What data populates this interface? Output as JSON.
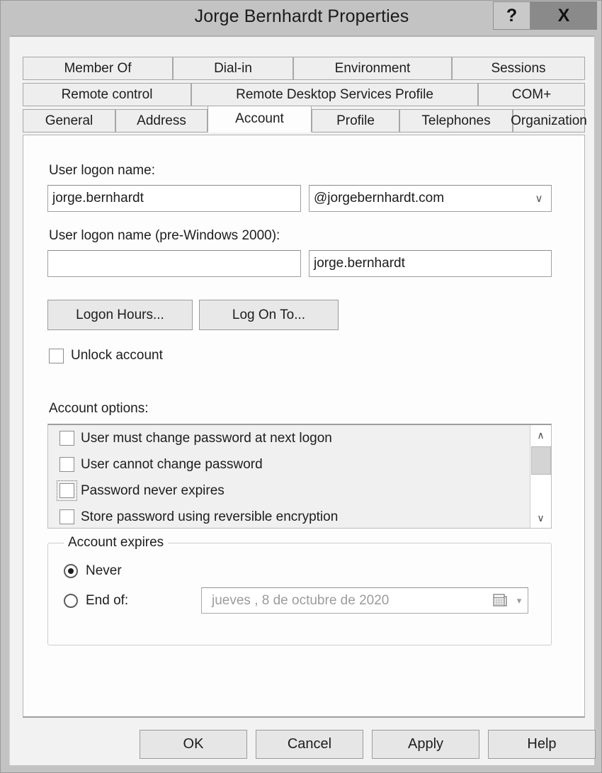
{
  "window": {
    "title": "Jorge Bernhardt Properties",
    "help_button": "?",
    "close_button": "X"
  },
  "tabs": {
    "row1": [
      {
        "id": "member-of",
        "label": "Member Of",
        "selected": false
      },
      {
        "id": "dial-in",
        "label": "Dial-in",
        "selected": false
      },
      {
        "id": "environment",
        "label": "Environment",
        "selected": false
      },
      {
        "id": "sessions",
        "label": "Sessions",
        "selected": false
      }
    ],
    "row2": [
      {
        "id": "remote-control",
        "label": "Remote control",
        "selected": false
      },
      {
        "id": "rds-profile",
        "label": "Remote Desktop Services Profile",
        "selected": false
      },
      {
        "id": "com-plus",
        "label": "COM+",
        "selected": false
      }
    ],
    "row3": [
      {
        "id": "general",
        "label": "General",
        "selected": false
      },
      {
        "id": "address",
        "label": "Address",
        "selected": false
      },
      {
        "id": "account",
        "label": "Account",
        "selected": true
      },
      {
        "id": "profile",
        "label": "Profile",
        "selected": false
      },
      {
        "id": "telephones",
        "label": "Telephones",
        "selected": false
      },
      {
        "id": "organization",
        "label": "Organization",
        "selected": false
      }
    ]
  },
  "account_tab": {
    "user_logon_name_label": "User logon name:",
    "user_logon_name_value": "jorge.bernhardt",
    "upn_suffix_value": "@jorgebernhardt.com",
    "upn_suffix_arrow": "∨",
    "pre_windows_label": "User logon name (pre-Windows 2000):",
    "pre_windows_domain_value": "",
    "pre_windows_name_value": "jorge.bernhardt",
    "logon_hours_button": "Logon Hours...",
    "log_on_to_button": "Log On To...",
    "unlock_account_label": "Unlock account",
    "unlock_account_checked": false,
    "account_options_label": "Account options:",
    "account_options": [
      {
        "label": "User must change password at next logon",
        "checked": false,
        "focused": false
      },
      {
        "label": "User cannot change password",
        "checked": false,
        "focused": false
      },
      {
        "label": "Password never expires",
        "checked": false,
        "focused": true
      },
      {
        "label": "Store password using reversible encryption",
        "checked": false,
        "focused": false
      }
    ],
    "scrollbar": {
      "up_arrow": "∧",
      "down_arrow": "∨"
    },
    "account_expires": {
      "legend": "Account expires",
      "never_label": "Never",
      "never_selected": true,
      "end_of_label": "End of:",
      "end_of_selected": false,
      "expiry_date": "jueves ,  8 de  octubre  de 2020",
      "dropdown_arrow": "▾"
    }
  },
  "buttons": {
    "ok": "OK",
    "cancel": "Cancel",
    "apply": "Apply",
    "help": "Help"
  }
}
